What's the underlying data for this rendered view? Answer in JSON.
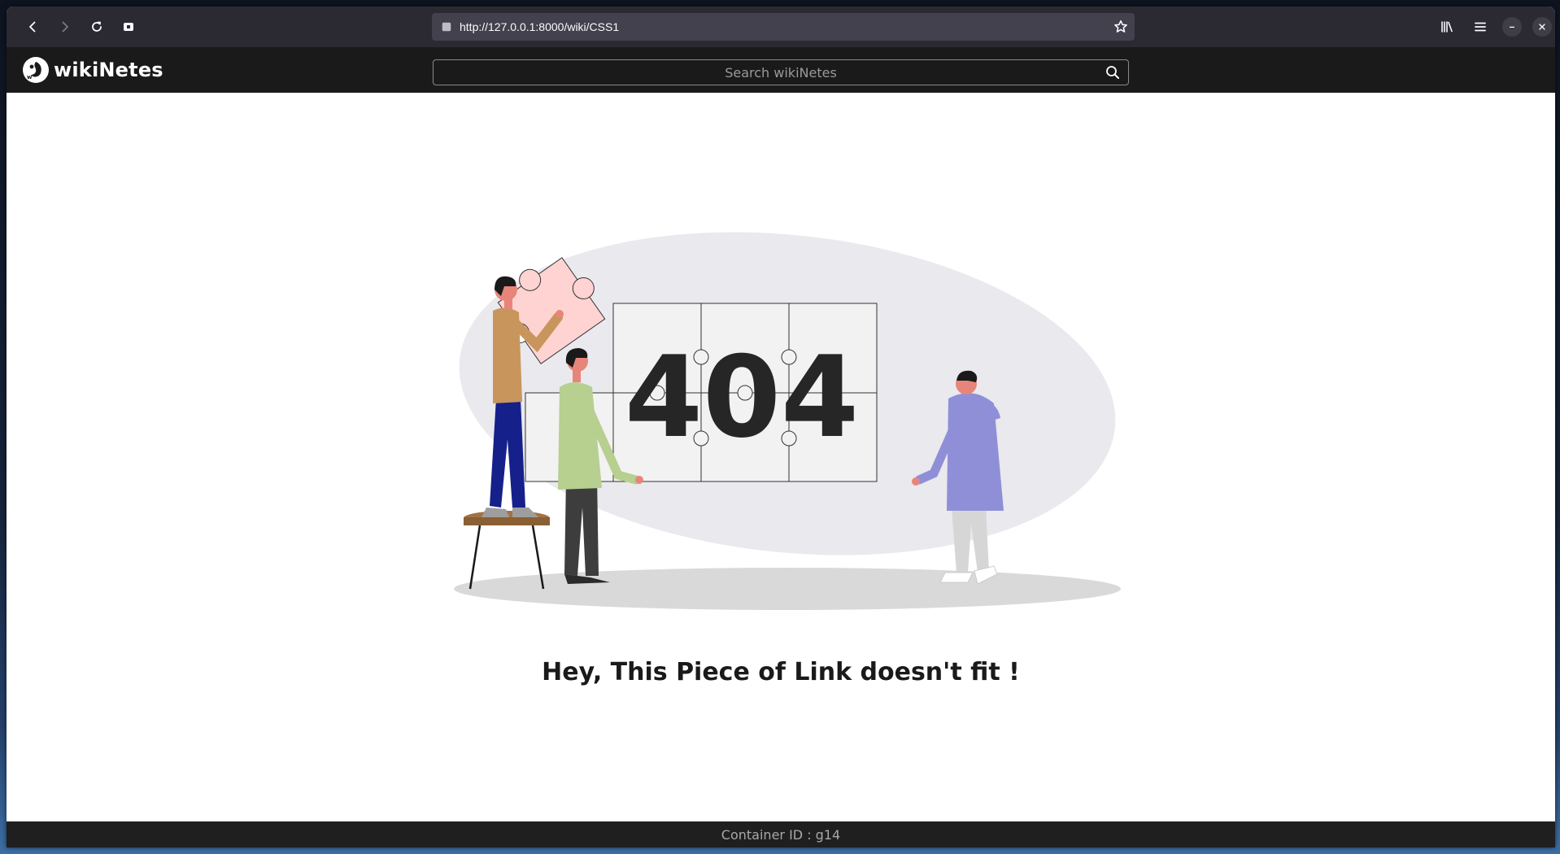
{
  "browser": {
    "url": "http://127.0.0.1:8000/wiki/CSS1",
    "icons": [
      "back-arrow-icon",
      "forward-arrow-icon",
      "reload-icon",
      "tab-icon",
      "star-icon",
      "library-icon",
      "hamburger-menu-icon",
      "minimize-icon",
      "close-icon"
    ]
  },
  "app": {
    "brand_name": "wikiNetes",
    "search_placeholder": "Search wikiNetes"
  },
  "error_page": {
    "code": "404",
    "message": "Hey, This Piece of Link doesn't fit !"
  },
  "footer": {
    "text": "Container ID : g14"
  },
  "colors": {
    "titlebar": "#2b2a33",
    "urlbar": "#42414d",
    "appbar": "#1a1a1a",
    "blob": "#e9e9ee",
    "puzzle_piece": "#ffd3d1",
    "shirt_tan": "#c8965c",
    "shirt_green": "#b7cf8f",
    "hoodie_purple": "#8f8fd8",
    "pants_navy": "#15208a"
  }
}
